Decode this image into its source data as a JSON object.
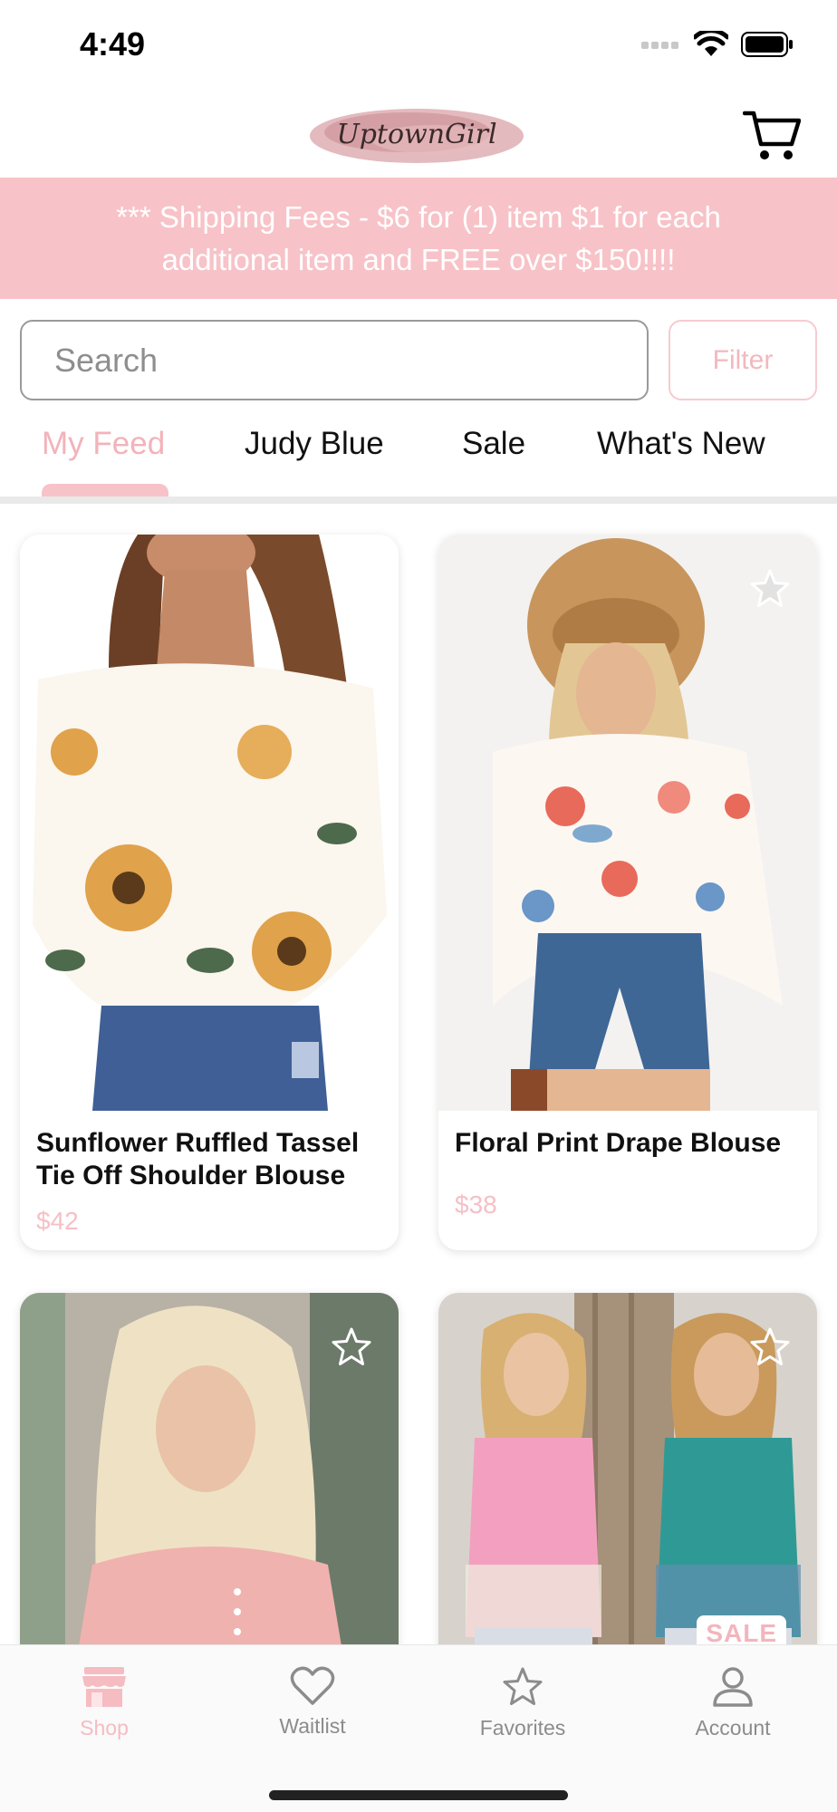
{
  "status_bar": {
    "time": "4:49"
  },
  "header": {
    "logo_text": "UptownGirl"
  },
  "banner": {
    "text": "*** Shipping Fees - $6 for (1) item $1 for each additional item and FREE over $150!!!!"
  },
  "search": {
    "placeholder": "Search",
    "value": ""
  },
  "filter": {
    "label": "Filter"
  },
  "tabs": [
    {
      "label": "My Feed",
      "active": true
    },
    {
      "label": "Judy Blue",
      "active": false
    },
    {
      "label": "Sale",
      "active": false
    },
    {
      "label": "What's New",
      "active": false
    }
  ],
  "products": [
    {
      "name": "Sunflower Ruffled Tassel Tie Off Shoulder Blouse",
      "price": "$42",
      "favorited": false
    },
    {
      "name": "Floral Print Drape Blouse",
      "price": "$38",
      "favorited": false
    },
    {
      "name": "",
      "price": "",
      "favorited": false
    },
    {
      "name": "",
      "price": "",
      "favorited": false,
      "badge": "SALE"
    }
  ],
  "tab_bar": [
    {
      "label": "Shop",
      "icon": "storefront-icon",
      "active": true
    },
    {
      "label": "Waitlist",
      "icon": "heart-icon",
      "active": false
    },
    {
      "label": "Favorites",
      "icon": "star-icon",
      "active": false
    },
    {
      "label": "Account",
      "icon": "person-icon",
      "active": false
    }
  ],
  "colors": {
    "accent_pink": "#f7c3c8",
    "price_pink": "#f5c0c6",
    "tab_active": "#f2b3ba"
  }
}
